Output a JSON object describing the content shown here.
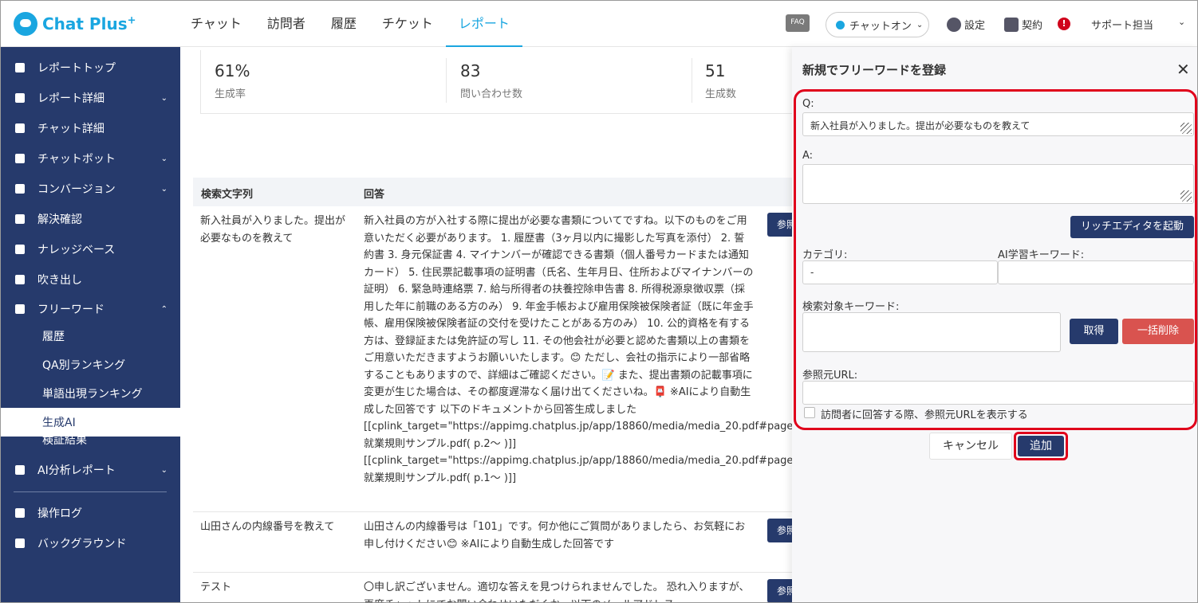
{
  "header": {
    "logo_text": "Chat Plus",
    "logo_sup": "+",
    "nav": [
      "チャット",
      "訪問者",
      "履歴",
      "チケット",
      "レポート"
    ],
    "active_nav": "レポート",
    "faq_label": "FAQ",
    "chat_status": "チャットオン",
    "settings_label": "設定",
    "contract_label": "契約",
    "alert_label": "!",
    "user_label": "サポート担当"
  },
  "sidebar": {
    "items": [
      {
        "label": "レポートトップ",
        "icon": "dashboard-icon"
      },
      {
        "label": "レポート詳細",
        "icon": "chart-icon",
        "expandable": true
      },
      {
        "label": "チャット詳細",
        "icon": "chat-icon"
      },
      {
        "label": "チャットボット",
        "icon": "bot-icon",
        "expandable": true
      },
      {
        "label": "コンバージョン",
        "icon": "star-icon",
        "expandable": true
      },
      {
        "label": "解決確認",
        "icon": "bulb-icon"
      },
      {
        "label": "ナレッジベース",
        "icon": "book-icon"
      },
      {
        "label": "吹き出し",
        "icon": "speech-icon"
      },
      {
        "label": "フリーワード",
        "icon": "abc-icon",
        "expandable": true
      }
    ],
    "sub_items": [
      "履歴",
      "QA別ランキング",
      "単語出現ランキング",
      "生成AI",
      "検証結果"
    ],
    "active_sub": "生成AI",
    "bottom_items": [
      {
        "label": "AI分析レポート",
        "icon": "bulb-icon",
        "expandable": true
      },
      {
        "label": "操作ログ",
        "icon": "list-icon"
      },
      {
        "label": "バックグラウンド",
        "icon": "sync-icon"
      }
    ]
  },
  "stats": [
    {
      "value": "61%",
      "label": "生成率"
    },
    {
      "value": "83",
      "label": "問い合わせ数"
    },
    {
      "value": "51",
      "label": "生成数"
    }
  ],
  "table": {
    "headers": [
      "検索文字列",
      "回答"
    ],
    "ref_label": "参照",
    "rows": [
      {
        "q": "新入社員が入りました。提出が必要なものを教えて",
        "a": "新入社員の方が入社する際に提出が必要な書類についてですね。以下のものをご用意いただく必要があります。 1. 履歴書（3ヶ月以内に撮影した写真を添付） 2. 誓約書 3. 身元保証書 4. マイナンバーが確認できる書類（個人番号カードまたは通知カード） 5. 住民票記載事項の証明書（氏名、生年月日、住所およびマイナンバーの証明） 6. 緊急時連絡票 7. 給与所得者の扶養控除申告書 8. 所得税源泉徴収票（採用した年に前職のある方のみ） 9. 年金手帳および雇用保険被保険者証（既に年金手帳、雇用保険被保険者証の交付を受けたことがある方のみ） 10. 公的資格を有する方は、登録証または免許証の写し 11. その他会社が必要と認めた書類以上の書類をご用意いただきますようお願いいたします。😊 ただし、会社の指示により一部省略することもありますので、詳細はご確認ください。📝 また、提出書類の記載事項に変更が生じた場合は、その都度遅滞なく届け出てくださいね。📮 ※AIにより自動生成した回答です 以下のドキュメントから回答生成しました [[cplink_target=\"https://appimg.chatplus.jp/app/18860/media/media_20.pdf#page=2\":就業規則サンプル.pdf( p.2～ )]] [[cplink_target=\"https://appimg.chatplus.jp/app/18860/media/media_20.pdf#page=1\":就業規則サンプル.pdf( p.1～ )]]"
      },
      {
        "q": "山田さんの内線番号を教えて",
        "a": "山田さんの内線番号は「101」です。何か他にご質問がありましたら、お気軽にお申し付けください😊 ※AIにより自動生成した回答です"
      },
      {
        "q": "テスト",
        "a": "〇申し訳ございません。適切な答えを見つけられませんでした。 恐れ入りますが、再度チャットにてお問い合わせいただくか、以下のメールアドレス"
      }
    ]
  },
  "panel": {
    "title": "新規でフリーワードを登録",
    "q_label": "Q:",
    "q_value": "新入社員が入りました。提出が必要なものを教えて",
    "a_label": "A:",
    "a_value": "",
    "rich_editor_button": "リッチエディタを起動",
    "category_label": "カテゴリ:",
    "category_value": "-",
    "ai_keyword_label": "AI学習キーワード:",
    "ai_keyword_value": "",
    "search_keyword_label": "検索対象キーワード:",
    "fetch_button": "取得",
    "bulk_delete_button": "一括削除",
    "ref_url_label": "参照元URL:",
    "ref_url_value": "",
    "show_url_checkbox_label": "訪問者に回答する際、参照元URLを表示する",
    "cancel_button": "キャンセル",
    "add_button": "追加"
  }
}
